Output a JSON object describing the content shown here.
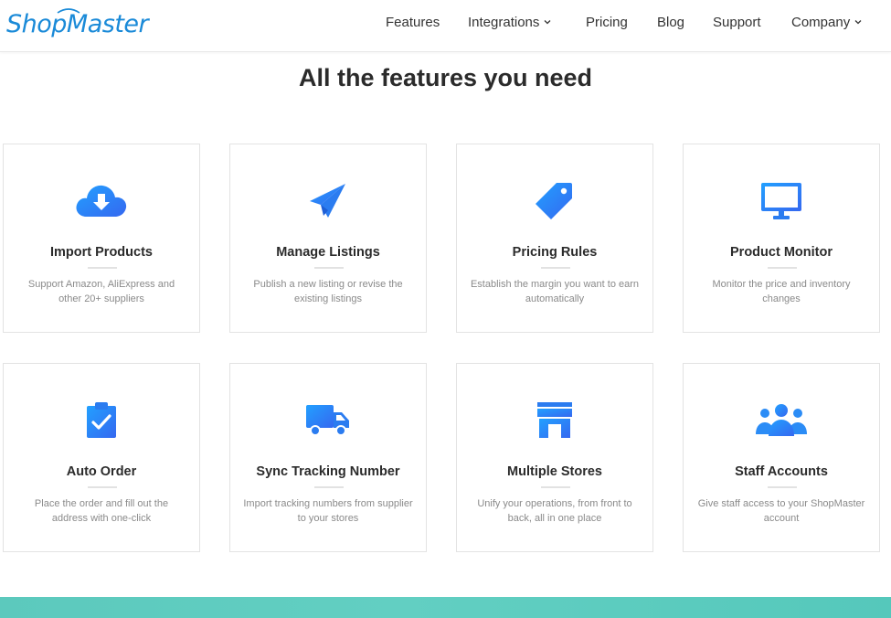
{
  "brand": {
    "name": "ShopMaster",
    "color": "#1a8ad8"
  },
  "nav": {
    "items": [
      {
        "label": "Features",
        "has_dropdown": false
      },
      {
        "label": "Integrations",
        "has_dropdown": true
      },
      {
        "label": "Pricing",
        "has_dropdown": false
      },
      {
        "label": "Blog",
        "has_dropdown": false
      },
      {
        "label": "Support",
        "has_dropdown": false
      },
      {
        "label": "Company",
        "has_dropdown": true
      }
    ]
  },
  "section": {
    "heading": "All the features you need"
  },
  "features": [
    {
      "title": "Import Products",
      "description": "Support Amazon, AliExpress and other 20+ suppliers",
      "icon": "cloud-download-icon"
    },
    {
      "title": "Manage Listings",
      "description": "Publish a new listing or revise the existing listings",
      "icon": "paper-plane-icon"
    },
    {
      "title": "Pricing Rules",
      "description": "Establish the margin you want to earn automatically",
      "icon": "price-tag-icon"
    },
    {
      "title": "Product Monitor",
      "description": "Monitor the price and inventory changes",
      "icon": "monitor-icon"
    },
    {
      "title": "Auto Order",
      "description": "Place the order and fill out the address with one-click",
      "icon": "clipboard-check-icon"
    },
    {
      "title": "Sync Tracking Number",
      "description": "Import tracking numbers from supplier to your stores",
      "icon": "delivery-truck-icon"
    },
    {
      "title": "Multiple Stores",
      "description": "Unify your operations, from front to back, all in one place",
      "icon": "storefront-icon"
    },
    {
      "title": "Staff Accounts",
      "description": "Give staff access to your ShopMaster account",
      "icon": "users-group-icon"
    }
  ],
  "colors": {
    "icon_gradient_start": "#1e90ff",
    "icon_gradient_end": "#3a6cf4",
    "footer_band": "#5cc9bd"
  }
}
